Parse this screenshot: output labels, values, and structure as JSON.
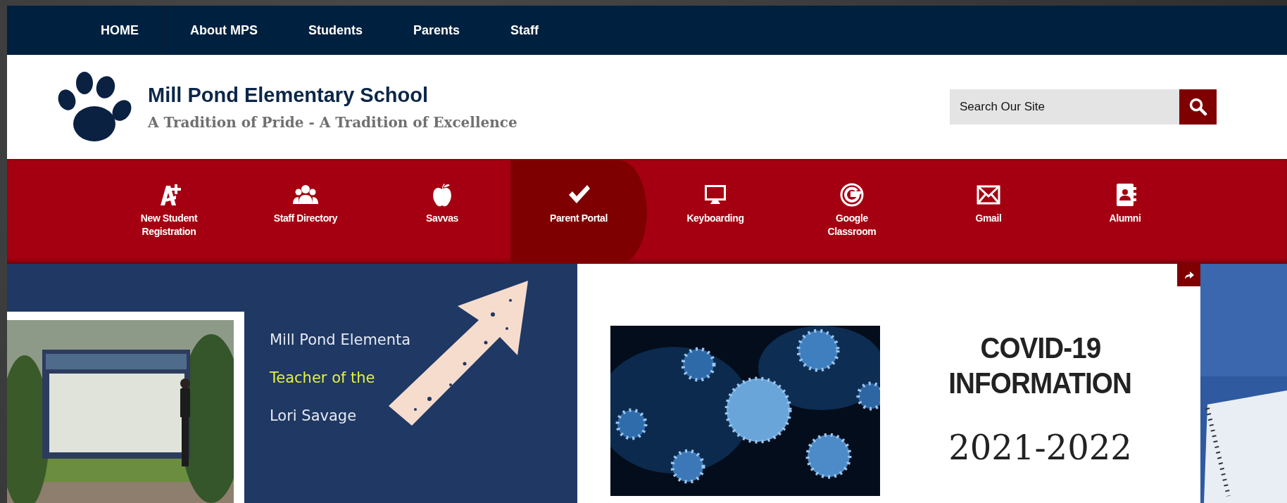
{
  "top_nav": [
    {
      "label": "HOME",
      "selected": true
    },
    {
      "label": "About MPS",
      "selected": false
    },
    {
      "label": "Students",
      "selected": false
    },
    {
      "label": "Parents",
      "selected": false
    },
    {
      "label": "Staff",
      "selected": false
    }
  ],
  "header": {
    "title": "Mill Pond Elementary School",
    "tagline": "A Tradition of Pride - A Tradition of Excellence"
  },
  "search": {
    "placeholder": "Search Our Site"
  },
  "quick_links": [
    {
      "label": "New Student Registration",
      "selected": false
    },
    {
      "label": "Staff Directory",
      "selected": false
    },
    {
      "label": "Savvas",
      "selected": false
    },
    {
      "label": "Parent Portal",
      "selected": true
    },
    {
      "label": "Keyboarding",
      "selected": false
    },
    {
      "label": "Google Classroom",
      "selected": false
    },
    {
      "label": "Gmail",
      "selected": false
    },
    {
      "label": "Alumni",
      "selected": false
    }
  ],
  "carousel": {
    "slides": [
      {
        "kind": "photo-text",
        "lines": [
          {
            "text": "Mill Pond Elementa",
            "color": "#e6e9f0"
          },
          {
            "text": "Teacher of the",
            "color": "#e6f03c"
          },
          {
            "text": "Lori Savage",
            "color": "#e6e9f0"
          }
        ]
      },
      {
        "kind": "info",
        "heading": [
          "COVID-19",
          "INFORMATION"
        ],
        "subheading": "2021-2022"
      },
      {
        "kind": "picture"
      }
    ]
  }
}
